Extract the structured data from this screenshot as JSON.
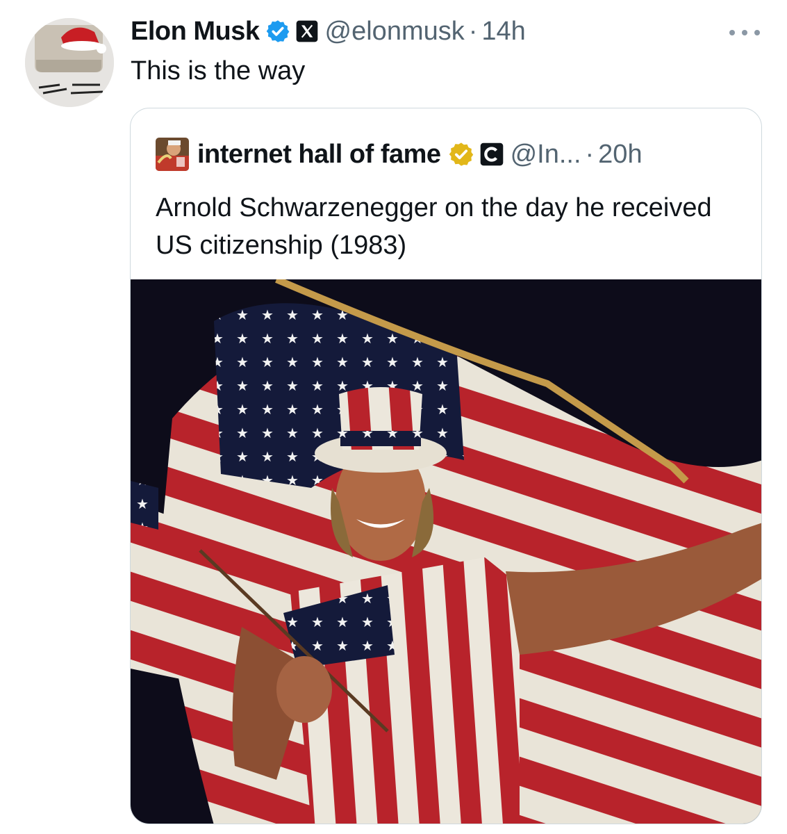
{
  "tweet": {
    "author_name": "Elon Musk",
    "author_handle": "@elonmusk",
    "separator": "·",
    "time": "14h",
    "text": "This is the way",
    "avatar_icon": "santa-hat-avatar-icon",
    "verified_icon": "blue-verified-badge-icon",
    "affiliation_icon": "x-logo-icon",
    "more_icon": "more-dots-icon"
  },
  "quoted": {
    "author_name": "internet hall of fame",
    "author_handle": "@In...",
    "separator": "·",
    "time": "20h",
    "text": "Arnold Schwarzenegger on the day he received US citizenship (1983)",
    "verified_icon": "gold-verified-badge-icon",
    "affiliation_icon": "c-logo-icon",
    "photo_icon": "man-in-flag-outfit-photo"
  },
  "colors": {
    "text": "#0f1419",
    "secondary": "#536471",
    "border": "#cfd9de",
    "blue_badge": "#1d9bf0",
    "gold_badge": "#e2b719"
  }
}
